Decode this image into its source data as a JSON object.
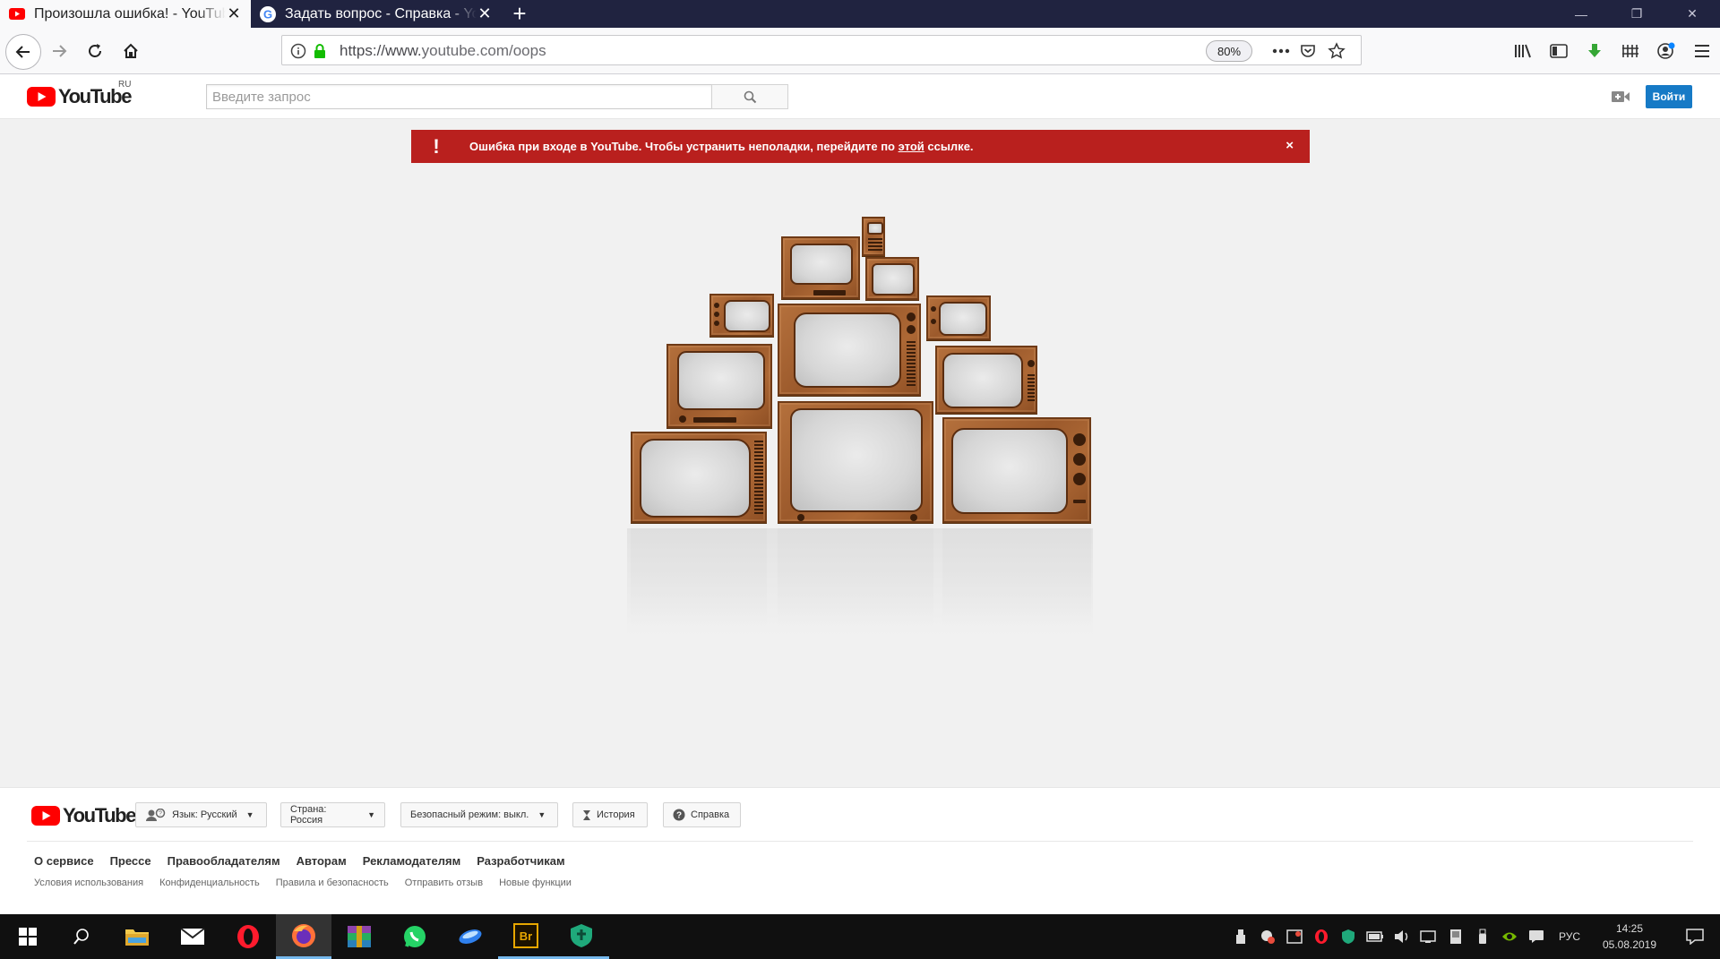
{
  "browser": {
    "tabs": [
      {
        "title": "Произошла ошибка! - YouTube",
        "close": "✕"
      },
      {
        "title": "Задать вопрос - Справка - YouTube",
        "close": "✕"
      }
    ],
    "new_tab": "+",
    "window_controls": {
      "minimize": "—",
      "restore": "❐",
      "close": "✕"
    },
    "url_scheme": "https://www.",
    "url_rest": "youtube.com/oops",
    "zoom": "80%"
  },
  "youtube": {
    "logo_text": "YouTube",
    "country_code": "RU",
    "search_placeholder": "Введите запрос",
    "signin_label": "Войти"
  },
  "error_banner": {
    "icon": "!",
    "text_before": "Ошибка при входе в YouTube. Чтобы устранить неполадки, перейдите по ",
    "link_text": "этой",
    "text_after": " ссылке.",
    "close": "×"
  },
  "footer": {
    "logo_text": "YouTube",
    "language": "Язык: Русский",
    "country": "Страна: Россия",
    "safe_mode": "Безопасный режим: выкл.",
    "history": "История",
    "help": "Справка",
    "links": [
      "О сервисе",
      "Прессе",
      "Правообладателям",
      "Авторам",
      "Рекламодателям",
      "Разработчикам"
    ],
    "sublinks": [
      "Условия использования",
      "Конфиденциальность",
      "Правила и безопасность",
      "Отправить отзыв",
      "Новые функции"
    ]
  },
  "taskbar": {
    "language": "РУС",
    "time": "14:25",
    "date": "05.08.2019"
  },
  "colors": {
    "youtube_red": "#ff0000",
    "error_red": "#b9201e",
    "signin_blue": "#167ac6",
    "tab_strip": "#202340"
  }
}
